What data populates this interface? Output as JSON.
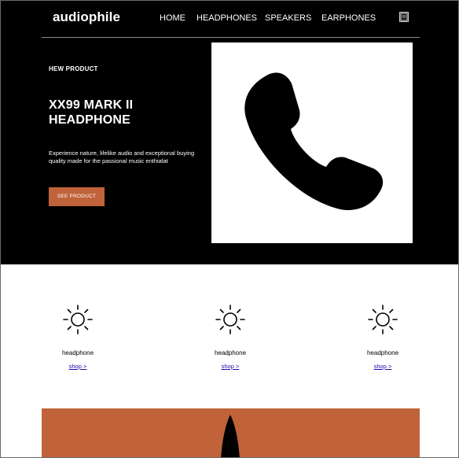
{
  "header": {
    "logo": "audiophile",
    "nav": [
      "HOME",
      "HEADPHONES",
      "SPEAKERS",
      "EARPHONES"
    ],
    "cart_icon": "cart-icon"
  },
  "hero": {
    "kicker": "HEW PRODUCT",
    "title": "XX99 MARK II HEADPHONE",
    "description": "Experience nature, lifelike audio and exceptional buying quality made for the passional music enthialat",
    "cta_label": "SEE PRODUCT",
    "image_icon": "phone-icon",
    "accent_color": "#c0633a"
  },
  "categories": [
    {
      "icon": "sun-icon",
      "label": "headphone",
      "link": "shop >"
    },
    {
      "icon": "sun-icon",
      "label": "headphone",
      "link": "shop >"
    },
    {
      "icon": "sun-icon",
      "label": "headphone",
      "link": "shop >"
    }
  ],
  "promo": {
    "background": "#c0633a",
    "image_icon": "speaker-icon"
  }
}
